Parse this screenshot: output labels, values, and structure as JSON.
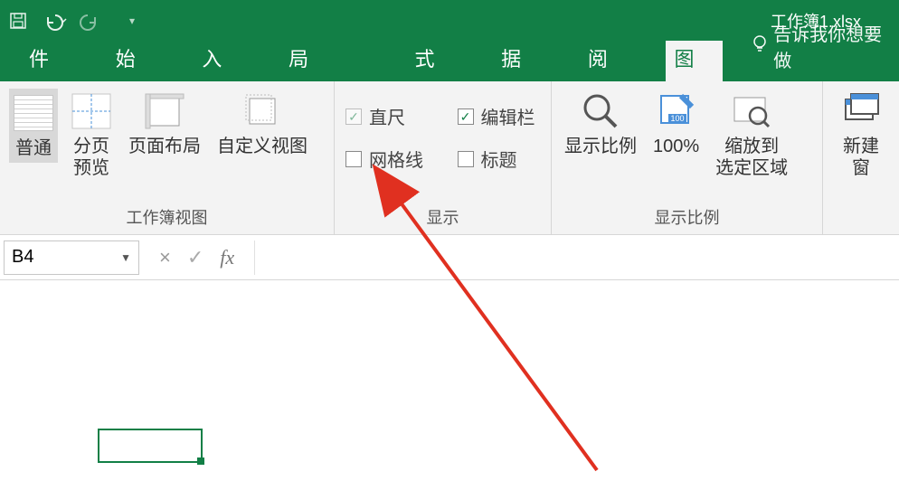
{
  "window": {
    "title": "工作簿1.xlsx"
  },
  "qat": {
    "save": "保存",
    "undo": "撤销",
    "redo": "重做"
  },
  "tabs": {
    "file": "文件",
    "home": "开始",
    "insert": "插入",
    "page_layout": "页面布局",
    "formulas": "公式",
    "data": "数据",
    "review": "审阅",
    "view": "视图",
    "tell_me": "告诉我你想要做"
  },
  "ribbon": {
    "workbook_views": {
      "label": "工作簿视图",
      "normal": "普通",
      "page_break": "分页\n预览",
      "page_layout": "页面布局",
      "custom_views": "自定义视图"
    },
    "show": {
      "label": "显示",
      "ruler": "直尺",
      "formula_bar": "编辑栏",
      "gridlines": "网格线",
      "headings": "标题"
    },
    "zoom": {
      "label": "显示比例",
      "zoom": "显示比例",
      "hundred": "100%",
      "selection": "缩放到\n选定区域"
    },
    "window": {
      "new_window": "新建窗"
    }
  },
  "formula_bar": {
    "cell_ref": "B4",
    "cancel": "×",
    "enter": "✓",
    "fx": "fx"
  }
}
